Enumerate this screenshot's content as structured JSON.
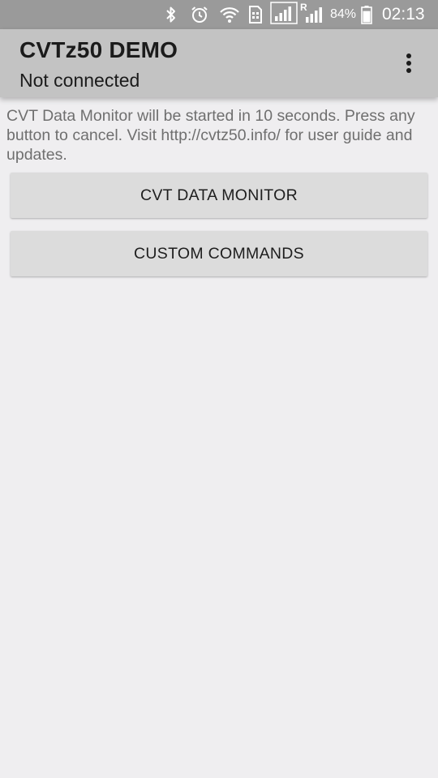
{
  "status_bar": {
    "icons": [
      "bluetooth-icon",
      "alarm-icon",
      "wifi-icon",
      "sim-icon",
      "signal-icon",
      "roaming-signal-icon",
      "battery-icon"
    ],
    "roaming_letter": "R",
    "battery_percent": "84%",
    "battery_level": 0.84,
    "time": "02:13"
  },
  "action_bar": {
    "title": "CVTz50 DEMO",
    "subtitle": "Not connected",
    "menu_icon": "overflow-menu-icon"
  },
  "content": {
    "message": "CVT Data Monitor will be started in 10 seconds. Press any button to cancel. Visit http://cvtz50.info/ for user guide and updates.",
    "buttons": [
      {
        "label": "CVT DATA MONITOR"
      },
      {
        "label": "CUSTOM COMMANDS"
      }
    ]
  },
  "colors": {
    "status_bar": "#9a9a9a",
    "action_bar": "#c3c3c3",
    "background": "#efeef0",
    "button": "#dcdcdc",
    "message_text": "#6f6f6f",
    "title_text": "#1b1b1b"
  }
}
